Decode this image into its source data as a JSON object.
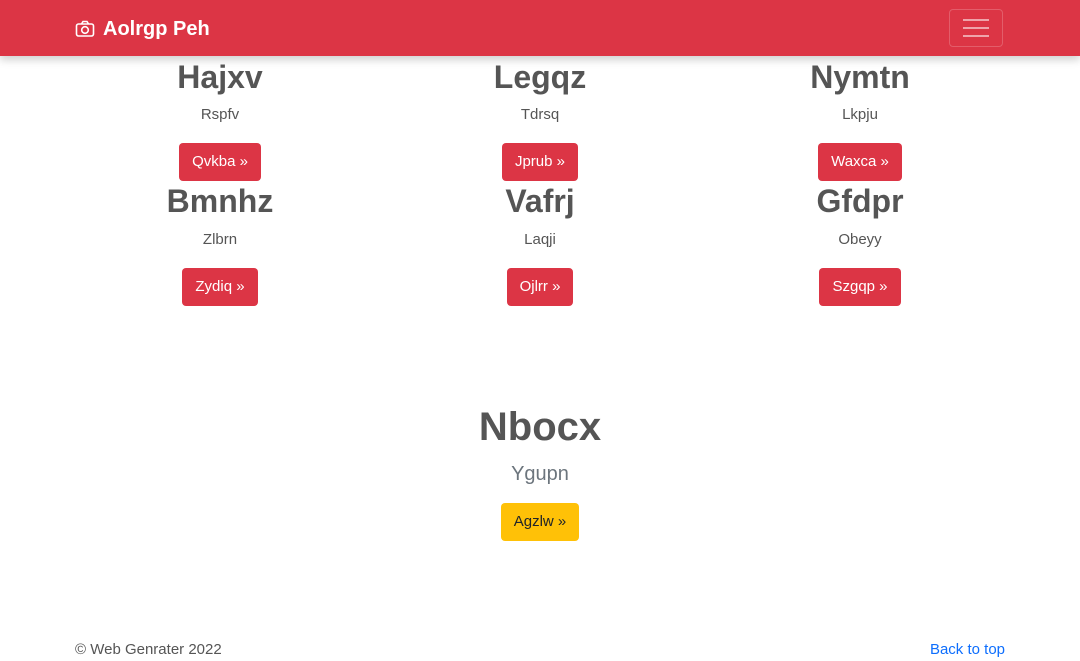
{
  "navbar": {
    "brand": "Aolrgp Peh",
    "brand_icon": "camera-icon",
    "toggler_icon": "hamburger-menu-icon",
    "color": "#dc3545"
  },
  "cards": [
    {
      "title": "Hajxv",
      "text": "Rspfv",
      "button": "Qvkba »"
    },
    {
      "title": "Legqz",
      "text": "Tdrsq",
      "button": "Jprub »"
    },
    {
      "title": "Nymtn",
      "text": "Lkpju",
      "button": "Waxca »"
    },
    {
      "title": "Bmnhz",
      "text": "Zlbrn",
      "button": "Zydiq »"
    },
    {
      "title": "Vafrj",
      "text": "Laqji",
      "button": "Ojlrr »"
    },
    {
      "title": "Gfdpr",
      "text": "Obeyy",
      "button": "Szgqp »"
    }
  ],
  "hero": {
    "title": "Nbocx",
    "lead": "Ygupn",
    "button": "Agzlw »",
    "button_color": "#ffc107"
  },
  "footer": {
    "copyright": "© Web Genrater 2022",
    "back_to_top": "Back to top",
    "link_color": "#0d6efd"
  }
}
